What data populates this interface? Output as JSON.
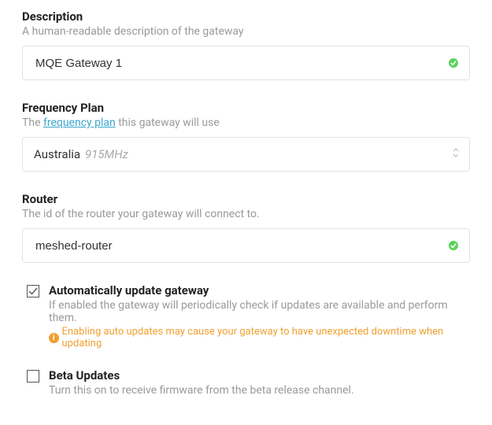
{
  "description": {
    "label": "Description",
    "help": "A human-readable description of the gateway",
    "value": "MQE Gateway 1",
    "valid": true
  },
  "frequency_plan": {
    "label": "Frequency Plan",
    "help_prefix": "The ",
    "help_link": "frequency plan",
    "help_suffix": " this gateway will use",
    "selected_country": "Australia",
    "selected_freq": "915MHz"
  },
  "router": {
    "label": "Router",
    "help": "The id of the router your gateway will connect to.",
    "value": "meshed-router",
    "valid": true
  },
  "auto_update": {
    "label": "Automatically update gateway",
    "help": "If enabled the gateway will periodically check if updates are available and perform them.",
    "warning": "Enabling auto updates may cause your gateway to have unexpected downtime when updating",
    "checked": true
  },
  "beta_updates": {
    "label": "Beta Updates",
    "help": "Turn this on to receive firmware from the beta release channel.",
    "checked": false
  }
}
